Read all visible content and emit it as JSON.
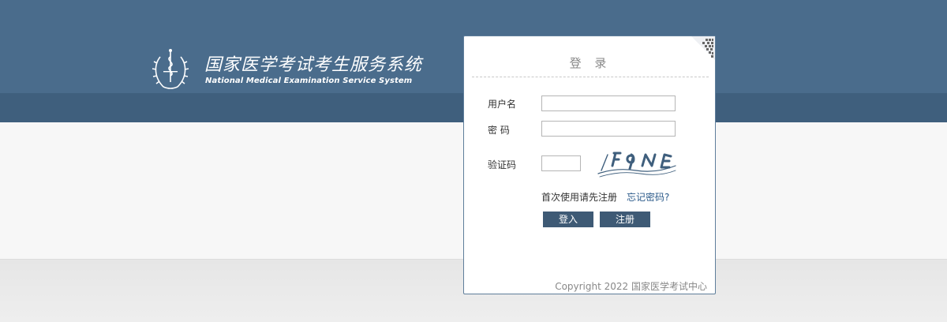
{
  "header": {
    "title": "国家医学考试考生服务系统",
    "subtitle": "National Medical Examination Service System"
  },
  "login": {
    "title": "登 录",
    "username_label": "用户名",
    "username_value": "",
    "password_label": "密 码",
    "password_value": "",
    "captcha_label": "验证码",
    "captcha_value": "",
    "first_use_text": "首次使用请先注册",
    "forgot_password": "忘记密码?",
    "login_button": "登入",
    "register_button": "注册",
    "copyright": "Copyright 2022 国家医学考试中心"
  },
  "colors": {
    "header_blue": "#4a6c8c",
    "header_dark": "#3f5f7d",
    "button": "#3e5a75",
    "link": "#2b5a8a"
  }
}
